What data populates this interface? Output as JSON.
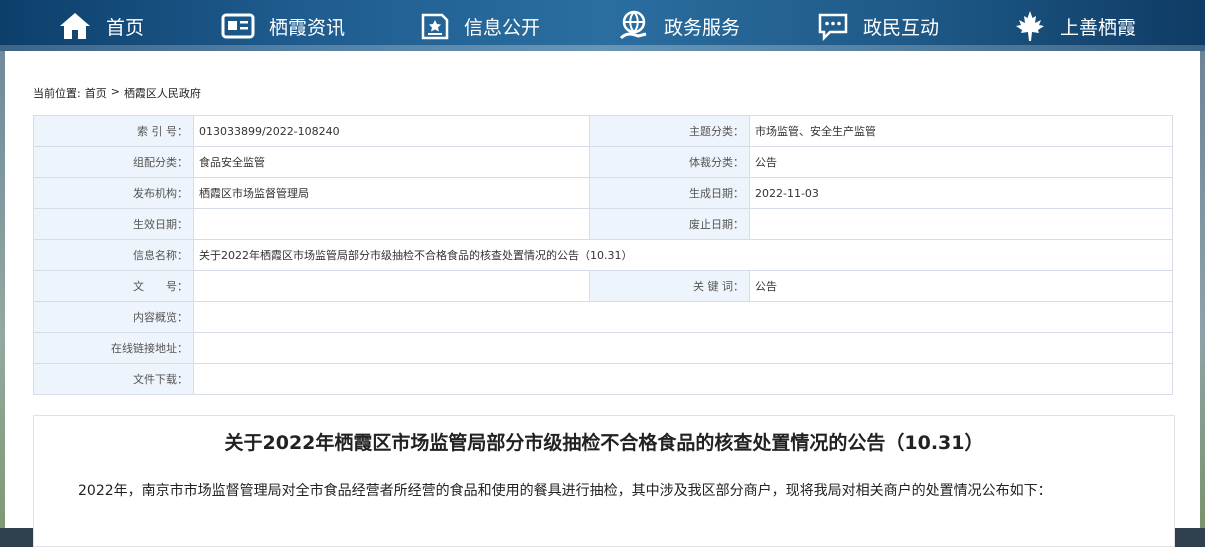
{
  "nav": {
    "items": [
      {
        "label": "首页",
        "icon": "home-icon"
      },
      {
        "label": "栖霞资讯",
        "icon": "news-icon"
      },
      {
        "label": "信息公开",
        "icon": "document-icon"
      },
      {
        "label": "政务服务",
        "icon": "globe-hand-icon"
      },
      {
        "label": "政民互动",
        "icon": "chat-icon"
      },
      {
        "label": "上善栖霞",
        "icon": "maple-leaf-icon"
      }
    ]
  },
  "breadcrumb": {
    "prefix": "当前位置:",
    "home": "首页",
    "sep": ">",
    "current": "栖霞区人民政府"
  },
  "meta": {
    "index_label": "索 引 号：",
    "index_value": "013033899/2022-108240",
    "topic_label": "主题分类：",
    "topic_value": "市场监管、安全生产监管",
    "org_cat_label": "组配分类：",
    "org_cat_value": "食品安全监管",
    "genre_label": "体裁分类：",
    "genre_value": "公告",
    "publisher_label": "发布机构：",
    "publisher_value": "栖霞区市场监督管理局",
    "created_label": "生成日期：",
    "created_value": "2022-11-03",
    "effective_label": "生效日期：",
    "effective_value": "",
    "expire_label": "废止日期：",
    "expire_value": "",
    "name_label": "信息名称：",
    "name_value": "关于2022年栖霞区市场监管局部分市级抽检不合格食品的核查处置情况的公告（10.31）",
    "docno_label": "文　　号：",
    "docno_value": "",
    "keywords_label": "关 键 词：",
    "keywords_value": "公告",
    "summary_label": "内容概览：",
    "summary_value": "",
    "link_label": "在线链接地址：",
    "link_value": "",
    "download_label": "文件下载：",
    "download_value": ""
  },
  "article": {
    "title": "关于2022年栖霞区市场监管局部分市级抽检不合格食品的核查处置情况的公告（10.31）",
    "body": "2022年，南京市市场监督管理局对全市食品经营者所经营的食品和使用的餐具进行抽检，其中涉及我区部分商户，现将我局对相关商户的处置情况公布如下："
  }
}
